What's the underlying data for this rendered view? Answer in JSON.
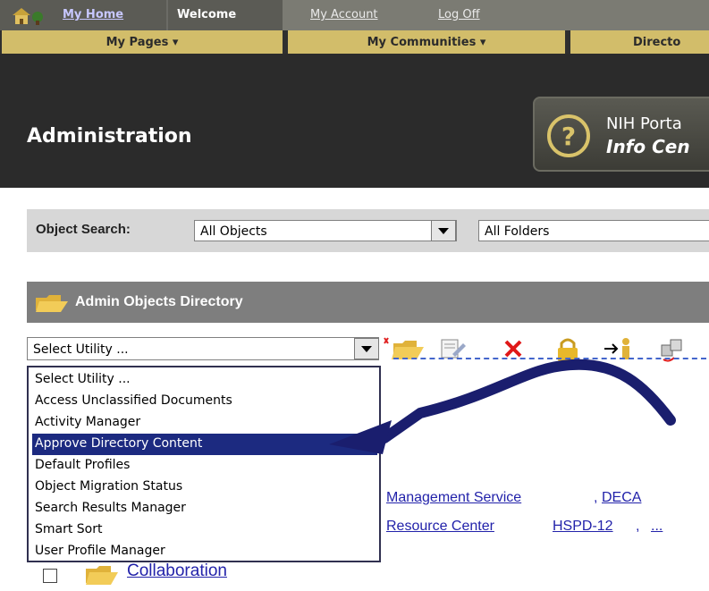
{
  "topnav": {
    "my_home": "My Home",
    "welcome": "Welcome",
    "my_account": "My Account",
    "log_off": "Log Off",
    "tabs": [
      "My Pages ▾",
      "My Communities ▾",
      "Directo"
    ]
  },
  "header": {
    "title": "Administration",
    "info_line1": "NIH Porta",
    "info_line2": "Info Cen"
  },
  "search": {
    "label": "Object Search:",
    "objects_value": "All Objects",
    "folders_value": "All Folders"
  },
  "directory": {
    "title": "Admin Objects Directory",
    "utility_value": "Select Utility ..."
  },
  "dropdown": {
    "options": [
      "Select Utility ...",
      "Access Unclassified Documents",
      "Activity Manager",
      "Approve Directory Content",
      "Default Profiles",
      "Object Migration Status",
      "Search Results Manager",
      "Smart Sort",
      "User Profile Manager"
    ],
    "selected_index": 3
  },
  "background_links": {
    "management": "Management Service",
    "deca": "DECA",
    "resource": "Resource Center",
    "hspd": "HSPD-12",
    "more": "...",
    "comma": ","
  },
  "collaboration": {
    "label": "Collaboration"
  },
  "colors": {
    "tab_gold": "#d2bd6a",
    "header_dark": "#2b2b2b",
    "selection": "#1c2a80",
    "link": "#2222aa",
    "annotation_arrow": "#1a1e6e"
  }
}
